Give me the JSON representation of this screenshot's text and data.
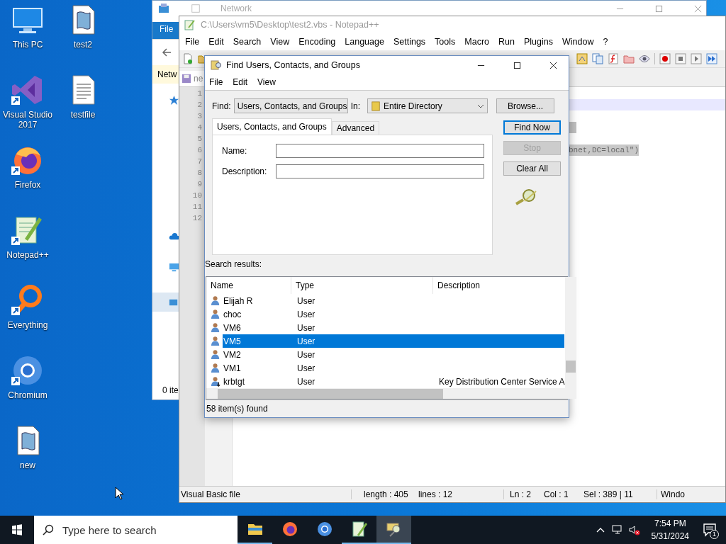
{
  "explorer": {
    "title": "Network",
    "ribbon_tab": "File",
    "address": "Netw",
    "status": "0 ite"
  },
  "desktop_icons": [
    {
      "label": "This PC",
      "kind": "pc",
      "shortcut": false
    },
    {
      "label": "Visual Studio 2017",
      "kind": "visual_studio",
      "shortcut": true
    },
    {
      "label": "Firefox",
      "kind": "firefox",
      "shortcut": true
    },
    {
      "label": "Notepad++",
      "kind": "notepad",
      "shortcut": true
    },
    {
      "label": "Everything",
      "kind": "everything",
      "shortcut": true
    },
    {
      "label": "Chromium",
      "kind": "chromium",
      "shortcut": true
    },
    {
      "label": "new",
      "kind": "script",
      "shortcut": false
    },
    {
      "label": "test2",
      "kind": "script",
      "shortcut": false
    },
    {
      "label": "testfile",
      "kind": "text",
      "shortcut": false
    }
  ],
  "notepad": {
    "title": "C:\\Users\\vm5\\Desktop\\test2.vbs - Notepad++",
    "menu": [
      "File",
      "Edit",
      "Search",
      "View",
      "Encoding",
      "Language",
      "Settings",
      "Tools",
      "Macro",
      "Run",
      "Plugins",
      "Window",
      "?"
    ],
    "tab": "ne",
    "line_numbers": [
      "1",
      "2",
      "3",
      "4",
      "5",
      "6",
      "7",
      "8",
      "9",
      "10",
      "11",
      "12"
    ],
    "code_fragment": "bnet,DC=local\")",
    "status_bar": [
      "Visual Basic file",
      "length : 405",
      "lines : 12",
      "Ln : 2",
      "Col : 1",
      "Sel : 389 | 11",
      "Windo"
    ]
  },
  "dialog": {
    "title": "Find Users, Contacts, and Groups",
    "menu": [
      "File",
      "Edit",
      "View"
    ],
    "find_label": "Find:",
    "find_value": "Users, Contacts, and Groups",
    "in_label": "In:",
    "in_value": "Entire Directory",
    "browse": "Browse...",
    "tabs": [
      {
        "label": "Users, Contacts, and Groups",
        "selected": true
      },
      {
        "label": "Advanced",
        "selected": false
      }
    ],
    "fields": [
      {
        "label": "Name:"
      },
      {
        "label": "Description:"
      }
    ],
    "buttons": [
      {
        "label": "Find Now",
        "disabled": false
      },
      {
        "label": "Stop",
        "disabled": true
      },
      {
        "label": "Clear All",
        "disabled": false
      }
    ],
    "results_label": "Search results:",
    "columns": [
      "Name",
      "Type",
      "Description"
    ],
    "rows": [
      {
        "name": "Elijah R",
        "type": "User",
        "kind": "user",
        "selected": false
      },
      {
        "name": "choc",
        "type": "User",
        "kind": "user",
        "selected": false
      },
      {
        "name": "VM6",
        "type": "User",
        "kind": "user",
        "selected": false
      },
      {
        "name": "VM5",
        "type": "User",
        "kind": "user",
        "selected": true
      },
      {
        "name": "VM2",
        "type": "User",
        "kind": "user",
        "selected": false
      },
      {
        "name": "VM1",
        "type": "User",
        "kind": "user",
        "selected": false
      },
      {
        "name": "krbtgt",
        "type": "User",
        "kind": "disabled_user",
        "description": "Key Distribution Center Service A",
        "selected": false
      }
    ],
    "status": "58 item(s) found"
  },
  "taskbar": {
    "search_placeholder": "Type here to search",
    "apps": [
      {
        "kind": "explorer",
        "running": true,
        "selected": false
      },
      {
        "kind": "firefox",
        "running": false,
        "selected": false
      },
      {
        "kind": "chromium",
        "running": false,
        "selected": false
      },
      {
        "kind": "notepad",
        "running": true,
        "selected": false
      },
      {
        "kind": "find",
        "running": true,
        "selected": true
      }
    ],
    "volume_muted": true,
    "time": "7:54 PM",
    "date": "5/31/2024",
    "notification_count": "1"
  }
}
